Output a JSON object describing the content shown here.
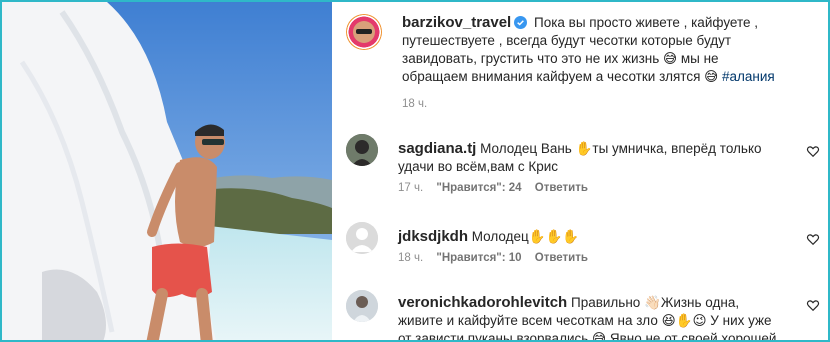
{
  "post": {
    "author": "barzikov_travel",
    "caption": "Пока вы просто живете , кайфуете , путешествуете , всегда будут чесотки которые будут завидовать, грустить что это не их жизнь 😅 мы не обращаем внимания кайфуем а чесотки злятся 😅",
    "hashtag": "#алания",
    "time": "18 ч."
  },
  "comments": [
    {
      "username": "sagdiana.tj",
      "text": "Молодец Вань ✋ты умничка, вперёд только удачи во всём,вам с Крис",
      "time": "17 ч.",
      "likes": "\"Нравится\": 24",
      "reply": "Ответить"
    },
    {
      "username": "jdksdjkdh",
      "text": "Молодец✋✋✋",
      "time": "18 ч.",
      "likes": "\"Нравится\": 10",
      "reply": "Ответить"
    },
    {
      "username": "veronichkadorohlevitch",
      "text": "Правильно 👋🏻Жизнь одна, живите и кайфуйте всем чесоткам на зло 😆✋😉 У них уже от зависти пуканы взорвались 😅 Явно не от своей хорошей",
      "time": "",
      "likes": "",
      "reply": ""
    }
  ],
  "colors": {
    "accent_verified": "#3897f0",
    "hashtag": "#00376b",
    "meta": "#8e8e8e",
    "frame": "#2fb8c8"
  },
  "icons": [
    "verified-icon",
    "heart-icon"
  ]
}
